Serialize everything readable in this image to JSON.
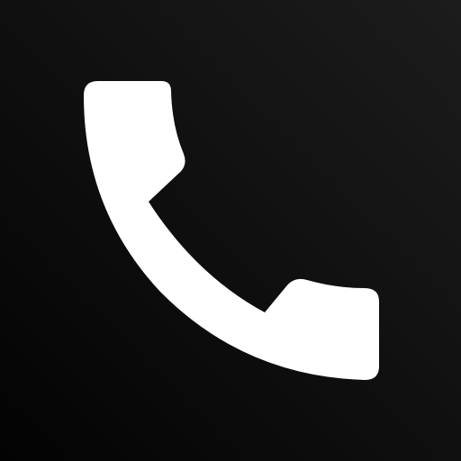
{
  "app_icon": {
    "name": "Phone",
    "glyph": "phone-handset-icon",
    "colors": {
      "background_dark": "#030303",
      "background_light": "#1c1c1c",
      "glyph": "#ffffff"
    }
  }
}
